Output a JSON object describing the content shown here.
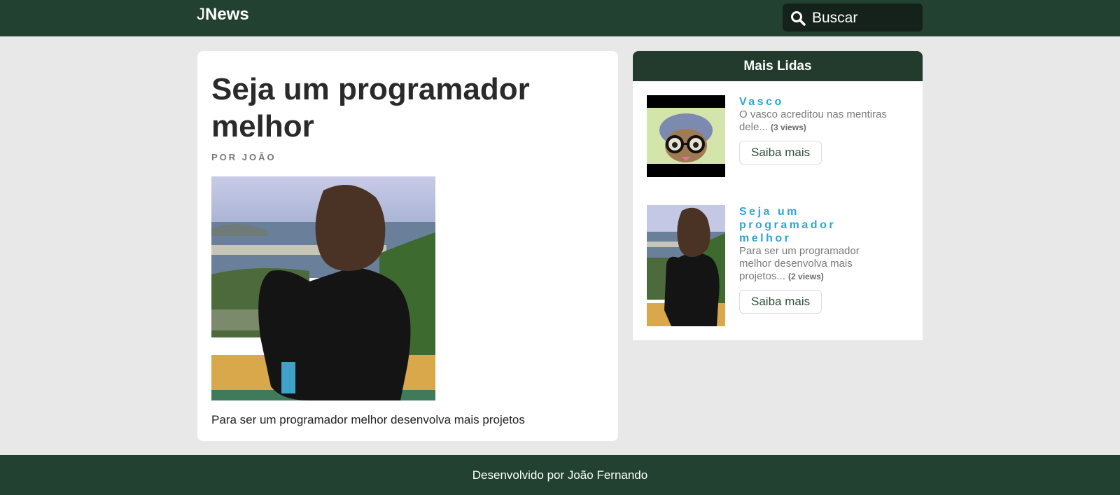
{
  "header": {
    "logo_light": "J",
    "logo_bold": "News",
    "search_placeholder": "Buscar"
  },
  "article": {
    "title": "Seja um programador melhor",
    "byline": "POR JOÃO",
    "body": "Para ser um programador melhor desenvolva mais projetos"
  },
  "sidebar": {
    "title": "Mais Lidas",
    "items": [
      {
        "title": "Vasco",
        "description": "O vasco acreditou nas mentiras dele...",
        "views": "(3 views)",
        "button": "Saiba mais"
      },
      {
        "title": "Seja um programador melhor",
        "description": "Para ser um programador melhor desenvolva mais projetos...",
        "views": "(2 views)",
        "button": "Saiba mais"
      }
    ]
  },
  "footer": {
    "text": "Desenvolvido por João Fernando"
  },
  "colors": {
    "header_bg": "#224130",
    "sidebar_header_bg": "#223b2c",
    "link_blue": "#2aa7d6",
    "page_bg": "#e8e8e8"
  }
}
